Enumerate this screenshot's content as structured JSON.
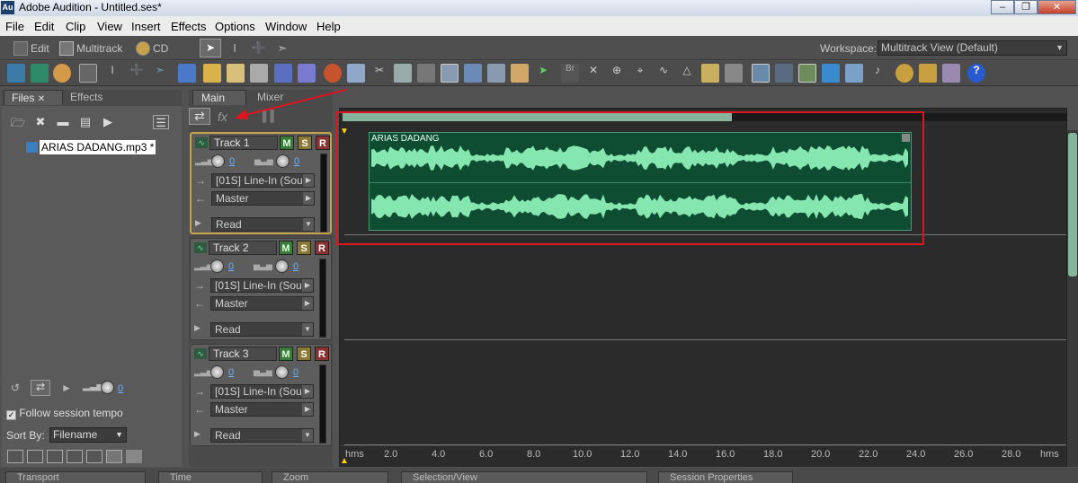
{
  "titlebar": {
    "app_icon": "Au",
    "title": "Adobe Audition - Untitled.ses*"
  },
  "menubar": [
    "File",
    "Edit",
    "Clip",
    "View",
    "Insert",
    "Effects",
    "Options",
    "Window",
    "Help"
  ],
  "viewbar": {
    "edit_label": "Edit",
    "multitrack_label": "Multitrack",
    "cd_label": "CD"
  },
  "workspace": {
    "label": "Workspace:",
    "value": "Multitrack View (Default)"
  },
  "files_panel": {
    "tab_files": "Files",
    "tab_effects": "Effects",
    "file_name": "ARIAS DADANG.mp3 *",
    "volume_value": "0",
    "follow_tempo_label": "Follow session tempo",
    "follow_tempo_checked": true,
    "sort_by_label": "Sort By:",
    "sort_by_value": "Filename"
  },
  "main_tabs": {
    "main": "Main",
    "mixer": "Mixer",
    "fx_label": "fx"
  },
  "tracks": [
    {
      "name": "Track 1",
      "vol": "0",
      "pan": "0",
      "input": "[01S] Line-In (Sou",
      "output": "Master",
      "automation": "Read",
      "m": "M",
      "s": "S",
      "r": "R"
    },
    {
      "name": "Track 2",
      "vol": "0",
      "pan": "0",
      "input": "[01S] Line-In (Sou",
      "output": "Master",
      "automation": "Read",
      "m": "M",
      "s": "S",
      "r": "R"
    },
    {
      "name": "Track 3",
      "vol": "0",
      "pan": "0",
      "input": "[01S] Line-In (Sou",
      "output": "Master",
      "automation": "Read",
      "m": "M",
      "s": "S",
      "r": "R"
    }
  ],
  "clip": {
    "label": "ARIAS DADANG",
    "color": "#86e6b0"
  },
  "ruler": {
    "unit_left": "hms",
    "unit_right": "hms",
    "ticks": [
      "2.0",
      "4.0",
      "6.0",
      "8.0",
      "10.0",
      "12.0",
      "14.0",
      "16.0",
      "18.0",
      "20.0",
      "22.0",
      "24.0",
      "26.0",
      "28.0"
    ]
  },
  "bottom_panels": [
    "Transport",
    "Time",
    "Zoom",
    "Selection/View",
    "Session Properties"
  ],
  "accent": {
    "highlight": "#e0141e",
    "selected_track": "#c7a54a",
    "overview": "#86b39b"
  }
}
